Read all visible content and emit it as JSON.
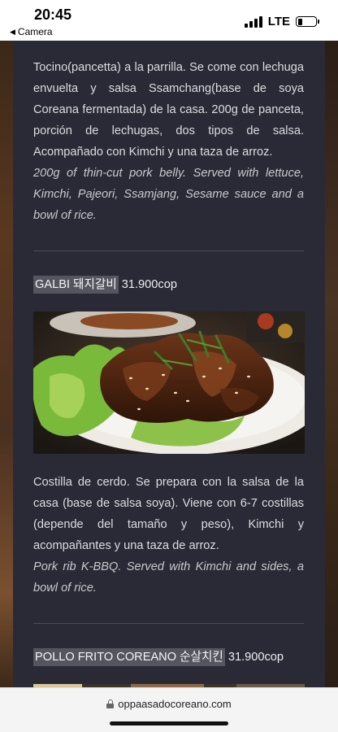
{
  "status_bar": {
    "time": "20:45",
    "back_label": "Camera",
    "network": "LTE"
  },
  "menu": {
    "samgyeopsal": {
      "description_es": "Tocino(pancetta) a la parrilla. Se come con lechuga envuelta y salsa Ssamchang(base de soya Coreana fermentada) de la casa. 200g de panceta, porción de lechugas, dos tipos de salsa. Acompañado con Kimchi y una taza de arroz.",
      "description_en": "200g of thin-cut pork belly. Served with lettuce, Kimchi, Pajeori, Ssamjang, Sesame sauce and a bowl of rice."
    },
    "galbi": {
      "name": "GALBI 돼지갈비",
      "price": "31.900cop",
      "description_es": "Costilla de cerdo. Se prepara con la salsa de la casa (base de salsa soya). Viene con 6-7 costillas (depende del tamaño y peso), Kimchi y acompañantes y una taza de arroz.",
      "description_en": "Pork rib K-BBQ. Served with Kimchi and sides, a bowl of rice."
    },
    "pollo_frito": {
      "name": "POLLO FRITO COREANO 순살치킨",
      "price": "31.900cop"
    }
  },
  "browser": {
    "url": "oppaasadocoreano.com"
  },
  "icons": {
    "back": "back-arrow-icon",
    "signal": "signal-icon",
    "battery": "battery-icon",
    "lock": "lock-icon"
  }
}
